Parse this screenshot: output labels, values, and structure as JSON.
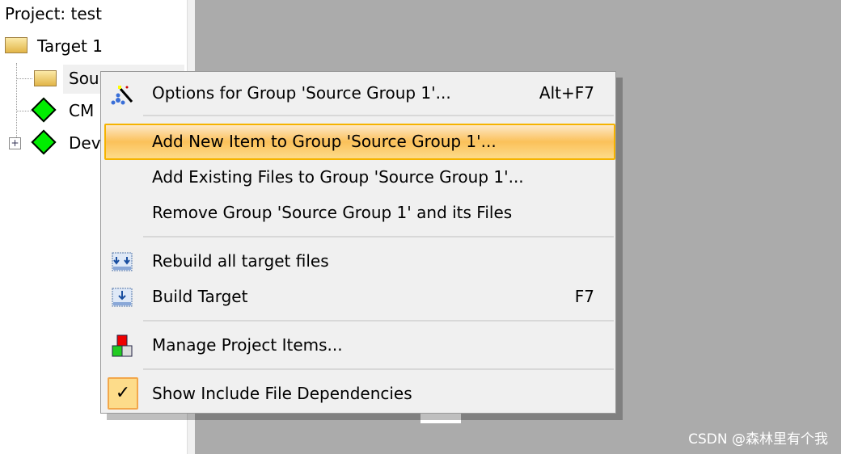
{
  "tree": {
    "project": "Project: test",
    "target": "Target 1",
    "items": [
      "Sou",
      "CM",
      "Dev"
    ]
  },
  "menu": {
    "items": [
      {
        "label": "Options for Group 'Source Group 1'...",
        "shortcut": "Alt+F7",
        "icon": "magic-wand-icon"
      },
      {
        "label": "Add New  Item to Group 'Source Group 1'...",
        "highlighted": true
      },
      {
        "label": "Add Existing Files to Group 'Source Group 1'..."
      },
      {
        "label": "Remove Group 'Source Group 1' and its Files"
      },
      {
        "label": "Rebuild all target files",
        "icon": "rebuild-icon"
      },
      {
        "label": "Build Target",
        "shortcut": "F7",
        "icon": "build-icon"
      },
      {
        "label": "Manage Project Items...",
        "icon": "manage-items-icon"
      },
      {
        "label": "Show Include File Dependencies",
        "checked": true,
        "icon": "check-icon"
      }
    ]
  },
  "watermark": "CSDN @森林里有个我",
  "colors": {
    "highlight": "#fbc15a",
    "highlight_border": "#f5b300",
    "background": "#ababab"
  }
}
